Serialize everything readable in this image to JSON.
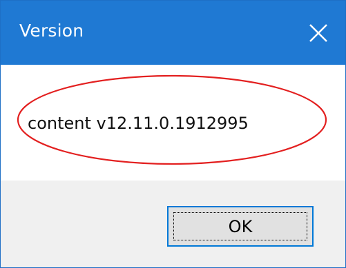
{
  "window": {
    "title": "Version",
    "close_icon": "close-icon"
  },
  "message": {
    "text": "content v12.11.0.1912995"
  },
  "buttons": {
    "ok_label": "OK"
  },
  "colors": {
    "titlebar": "#1f79d3",
    "highlight": "#e32020",
    "button_border": "#0078d7"
  }
}
